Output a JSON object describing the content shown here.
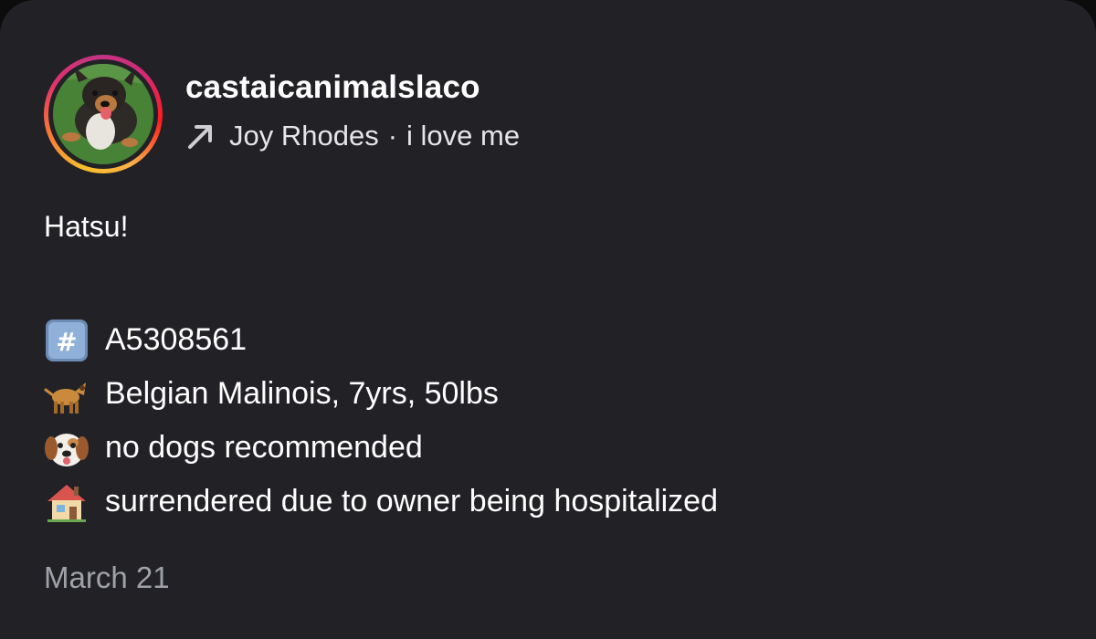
{
  "post": {
    "username": "castaicanimalslaco",
    "repost": {
      "icon": "repost-arrow-icon",
      "name": "Joy Rhodes",
      "separator": "·",
      "note": "i love me"
    },
    "title": "Hatsu!",
    "facts": [
      {
        "icon": "hash-keycap-icon",
        "text": "A5308561"
      },
      {
        "icon": "dog-icon",
        "text": "Belgian Malinois, 7yrs, 50lbs"
      },
      {
        "icon": "dog-face-icon",
        "text": "no dogs recommended"
      },
      {
        "icon": "house-icon",
        "text": "surrendered due to owner being hospitalized"
      }
    ],
    "date": "March 21"
  },
  "colors": {
    "background": "#212126",
    "text": "#ffffff",
    "muted": "#a0a2aa"
  }
}
